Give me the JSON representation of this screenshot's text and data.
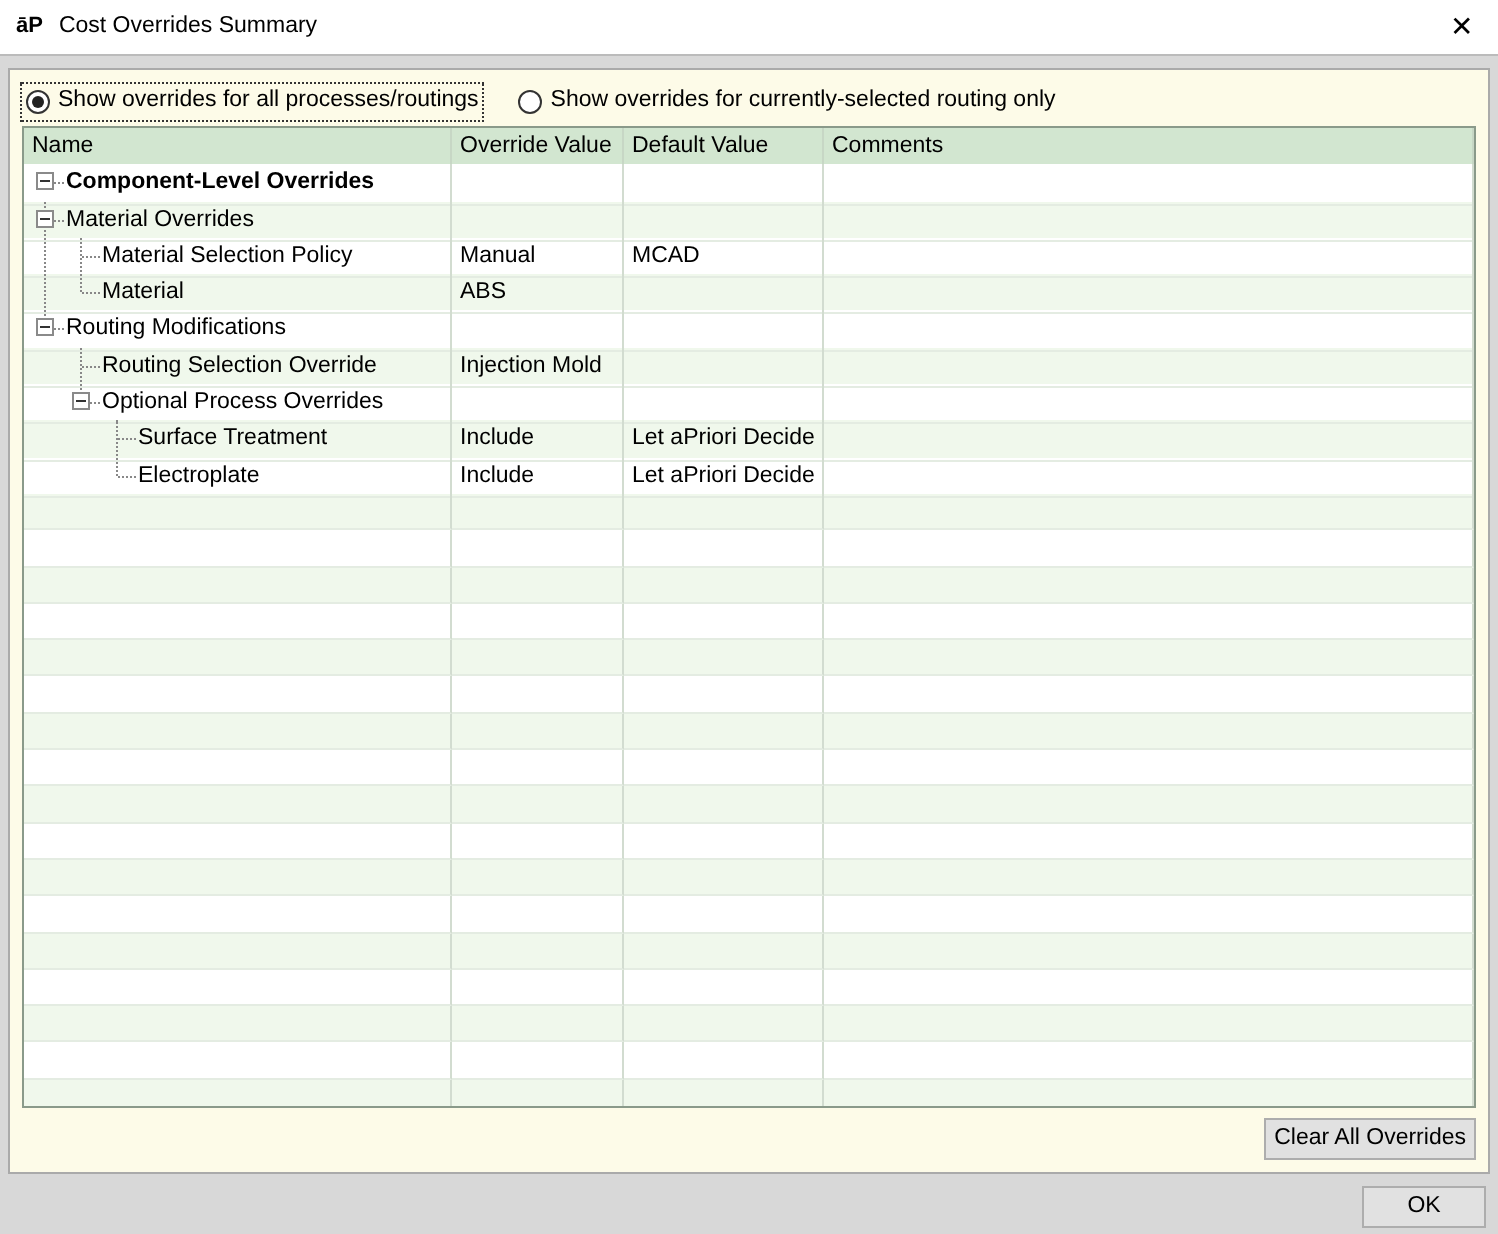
{
  "window": {
    "logo": "āP",
    "title": "Cost Overrides Summary",
    "close": "✕"
  },
  "options": [
    {
      "label": "Show overrides for all processes/routings",
      "selected": true
    },
    {
      "label": "Show overrides for currently-selected routing only",
      "selected": false
    }
  ],
  "table": {
    "columns": [
      "Name",
      "Override Value",
      "Default Value",
      "Comments"
    ],
    "rows": [
      {
        "name": "Component-Level Overrides",
        "bold": true,
        "expanded": true,
        "children": [
          {
            "name": "Material Overrides",
            "expanded": true,
            "children": [
              {
                "name": "Material Selection Policy",
                "override": "Manual",
                "default": "MCAD"
              },
              {
                "name": "Material",
                "override": "ABS"
              }
            ]
          },
          {
            "name": "Routing Modifications",
            "expanded": true,
            "children": [
              {
                "name": "Routing Selection Override",
                "override": "Injection Mold"
              },
              {
                "name": "Optional Process Overrides",
                "expanded": true,
                "children": [
                  {
                    "name": "Surface Treatment",
                    "override": "Include",
                    "default": "Let aPriori Decide"
                  },
                  {
                    "name": "Electroplate",
                    "override": "Include",
                    "default": "Let aPriori Decide"
                  }
                ]
              }
            ]
          }
        ]
      }
    ]
  },
  "buttons": {
    "clear": "Clear All Overrides",
    "ok": "OK"
  }
}
